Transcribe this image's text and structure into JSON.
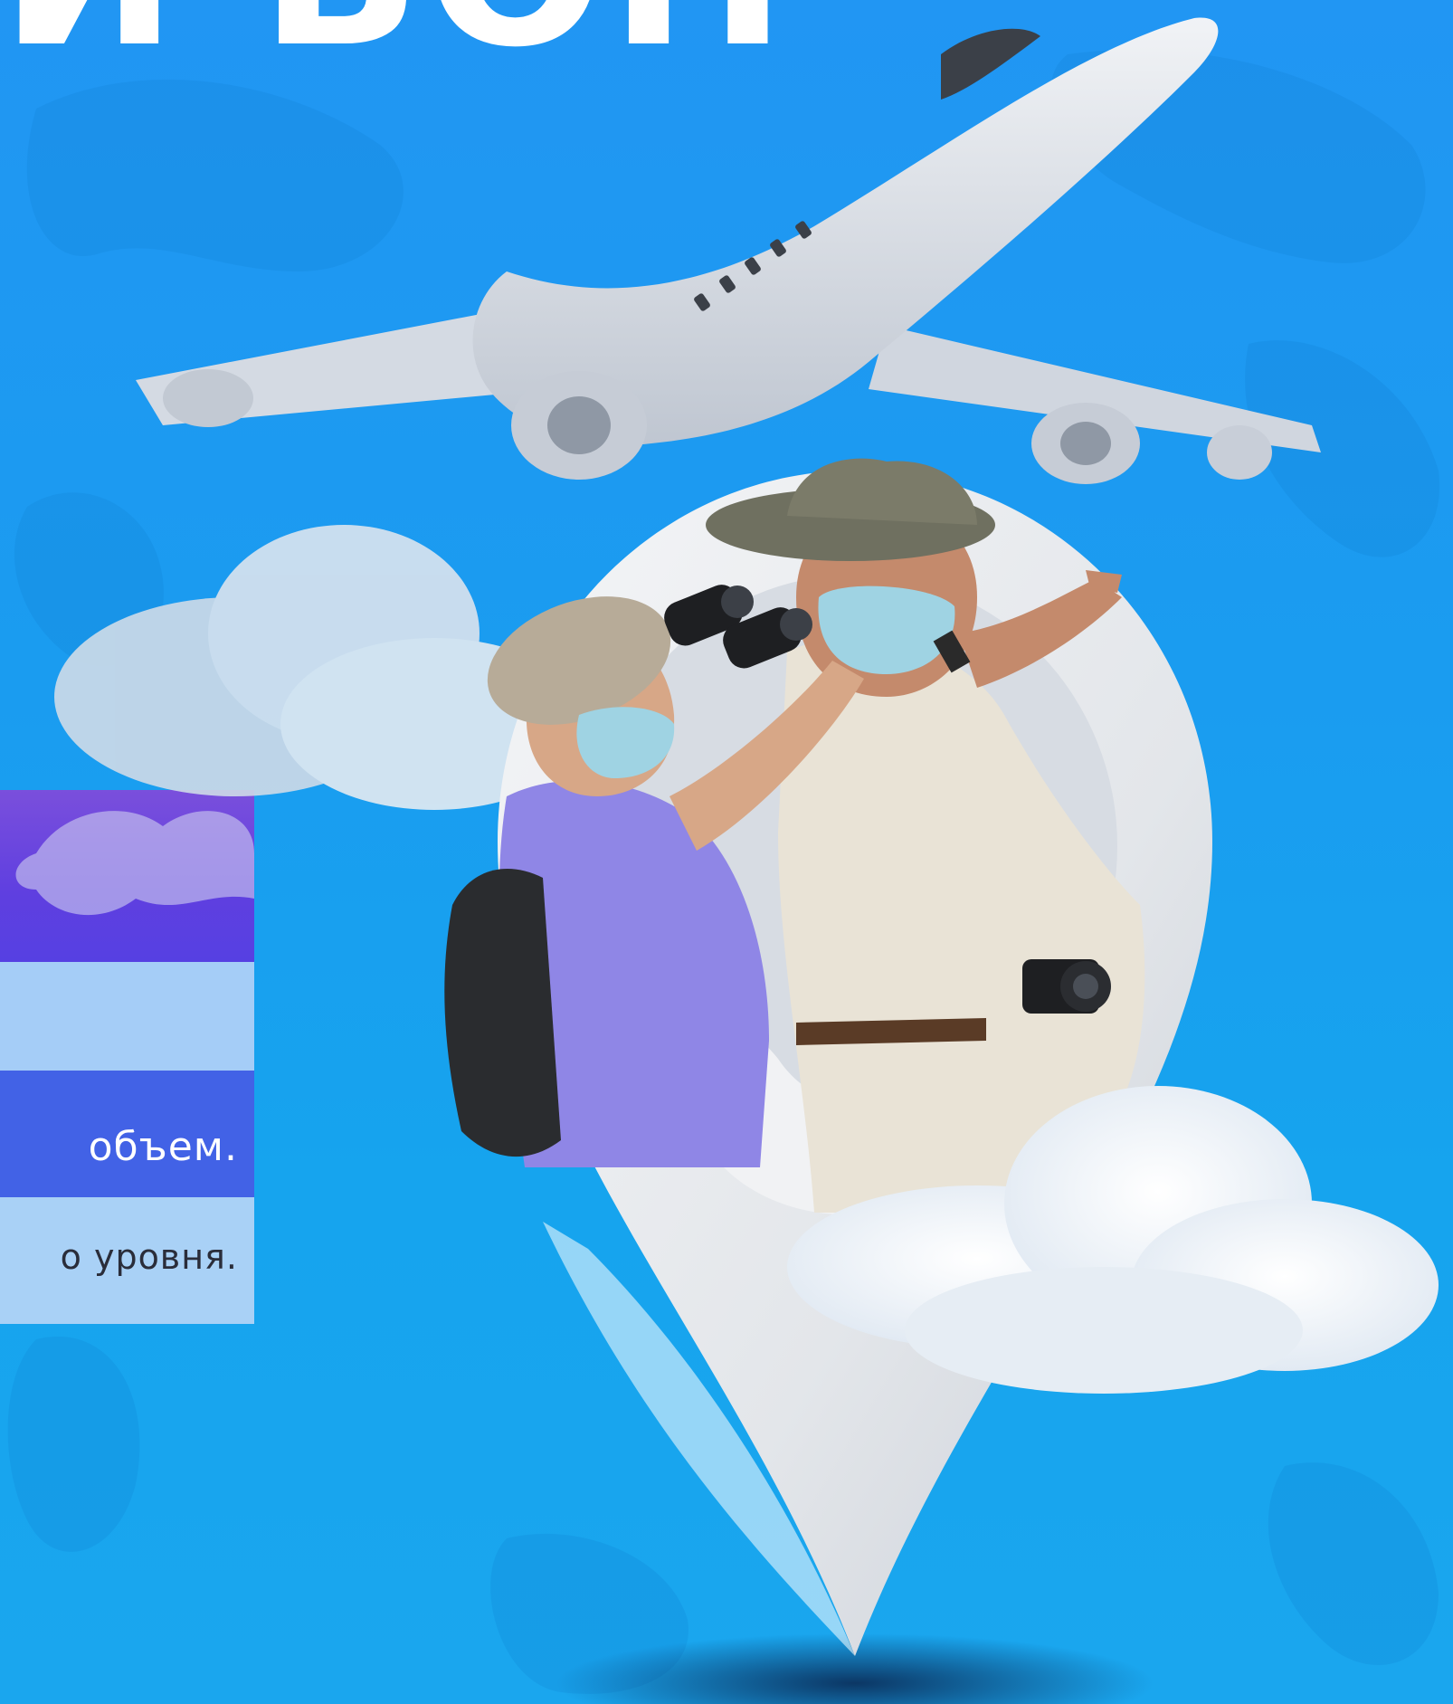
{
  "poster": {
    "headline": "И БОНУС",
    "band_line_1": "объем.",
    "band_line_2": "о уровня."
  },
  "colors": {
    "sky": "#1a9cf0",
    "band_violet": "#5f3fe0",
    "band_light": "#a5cdf7",
    "band_blue": "#4262e6",
    "band_pale": "#a9d1f6",
    "pin": "#e9ebee",
    "plane": "#e6e9ee"
  },
  "icons": [
    "airplane-icon",
    "map-pin-icon",
    "cloud-icon",
    "binoculars-icon",
    "camera-icon"
  ]
}
